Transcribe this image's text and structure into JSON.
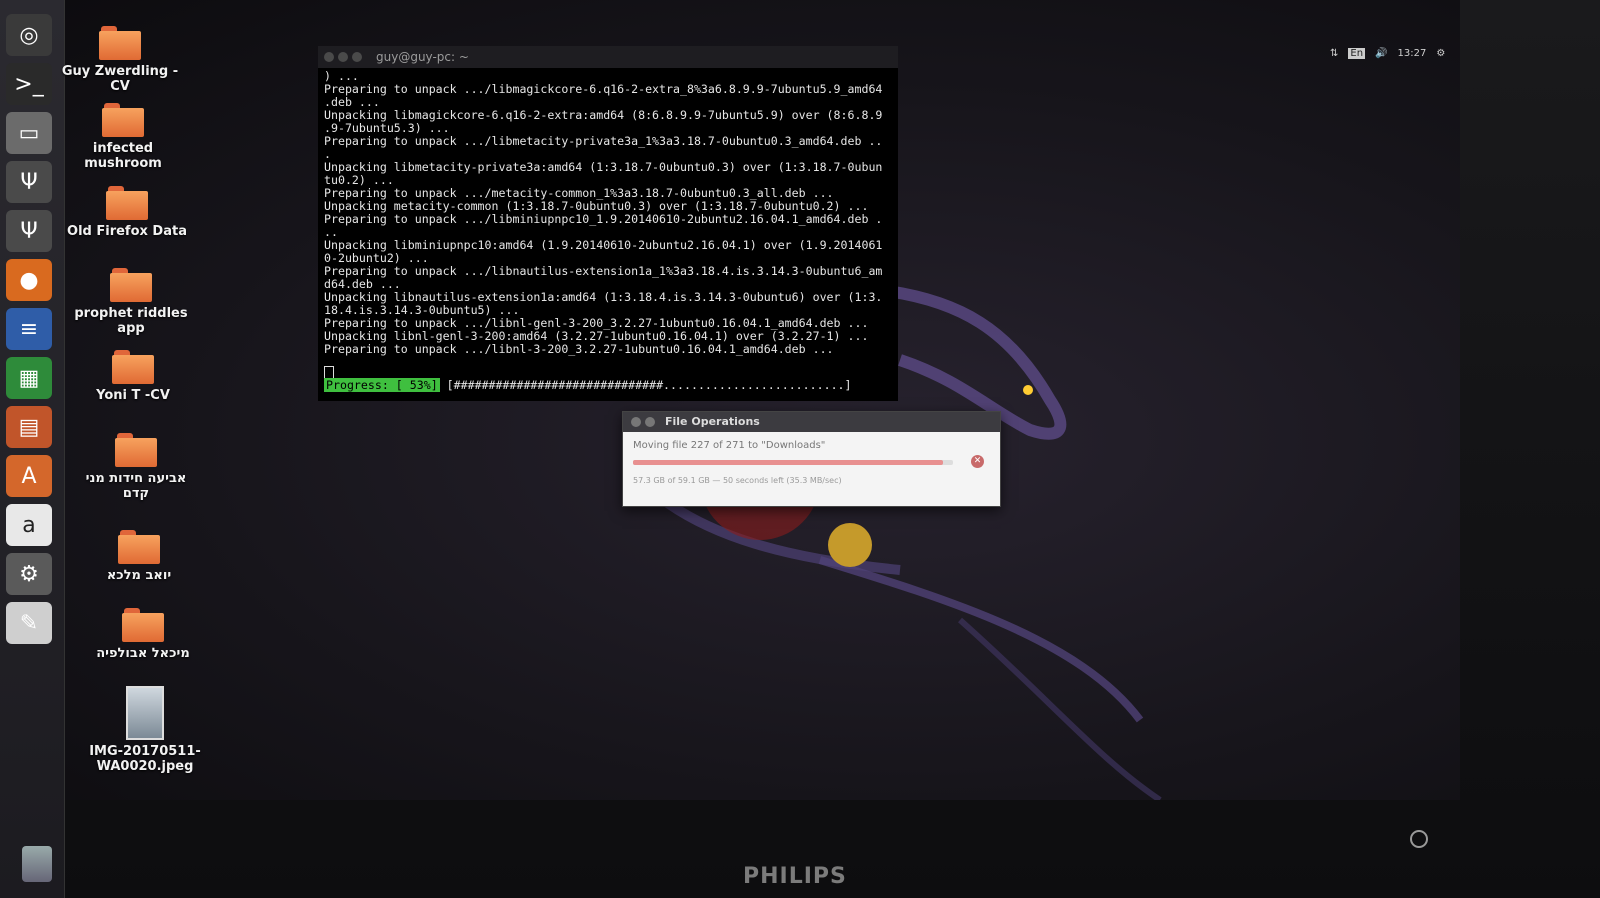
{
  "launcher": {
    "items": [
      {
        "name": "ubuntu-home-icon",
        "glyph": "◎",
        "bg": "#3a3a3a"
      },
      {
        "name": "terminal-icon",
        "glyph": ">_",
        "bg": "#2a2a2a"
      },
      {
        "name": "files-icon",
        "glyph": "▭",
        "bg": "#6b6b6b"
      },
      {
        "name": "usb-drive-icon",
        "glyph": "Ψ",
        "bg": "#4a4a4a"
      },
      {
        "name": "usb-drive-2-icon",
        "glyph": "Ψ",
        "bg": "#4a4a4a"
      },
      {
        "name": "firefox-icon",
        "glyph": "●",
        "bg": "#d96a1f"
      },
      {
        "name": "writer-icon",
        "glyph": "≡",
        "bg": "#2f5da8"
      },
      {
        "name": "calc-icon",
        "glyph": "▦",
        "bg": "#2e8b3a"
      },
      {
        "name": "impress-icon",
        "glyph": "▤",
        "bg": "#c1552a"
      },
      {
        "name": "software-center-icon",
        "glyph": "A",
        "bg": "#d4672b"
      },
      {
        "name": "amazon-icon",
        "glyph": "a",
        "bg": "#e8e8e8"
      },
      {
        "name": "settings-icon",
        "glyph": "⚙",
        "bg": "#5a5a5a"
      },
      {
        "name": "text-editor-icon",
        "glyph": "✎",
        "bg": "#cfcfcf"
      }
    ]
  },
  "desktop": {
    "icons": [
      {
        "label": "Guy Zwerdling - CV",
        "type": "folder"
      },
      {
        "label": "infected mushroom",
        "type": "folder"
      },
      {
        "label": "Old Firefox Data",
        "type": "folder"
      },
      {
        "label": "prophet riddles app",
        "type": "folder"
      },
      {
        "label": "Yoni T -CV",
        "type": "folder"
      },
      {
        "label": "אביעה חידות מני קדם",
        "type": "folder"
      },
      {
        "label": "יואב מלכא",
        "type": "folder"
      },
      {
        "label": "מיכאל אבולפיה",
        "type": "folder"
      },
      {
        "label": "IMG-20170511-WA0020.jpeg",
        "type": "image"
      }
    ]
  },
  "terminal": {
    "title": "guy@guy-pc: ~",
    "lines": [
      ") ...",
      "Preparing to unpack .../libmagickcore-6.q16-2-extra_8%3a6.8.9.9-7ubuntu5.9_amd64",
      ".deb ...",
      "Unpacking libmagickcore-6.q16-2-extra:amd64 (8:6.8.9.9-7ubuntu5.9) over (8:6.8.9",
      ".9-7ubuntu5.3) ...",
      "Preparing to unpack .../libmetacity-private3a_1%3a3.18.7-0ubuntu0.3_amd64.deb ..",
      ".",
      "Unpacking libmetacity-private3a:amd64 (1:3.18.7-0ubuntu0.3) over (1:3.18.7-0ubun",
      "tu0.2) ...",
      "Preparing to unpack .../metacity-common_1%3a3.18.7-0ubuntu0.3_all.deb ...",
      "Unpacking metacity-common (1:3.18.7-0ubuntu0.3) over (1:3.18.7-0ubuntu0.2) ...",
      "Preparing to unpack .../libminiupnpc10_1.9.20140610-2ubuntu2.16.04.1_amd64.deb .",
      "..",
      "Unpacking libminiupnpc10:amd64 (1.9.20140610-2ubuntu2.16.04.1) over (1.9.2014061",
      "0-2ubuntu2) ...",
      "Preparing to unpack .../libnautilus-extension1a_1%3a3.18.4.is.3.14.3-0ubuntu6_am",
      "d64.deb ...",
      "Unpacking libnautilus-extension1a:amd64 (1:3.18.4.is.3.14.3-0ubuntu6) over (1:3.",
      "18.4.is.3.14.3-0ubuntu5) ...",
      "Preparing to unpack .../libnl-genl-3-200_3.2.27-1ubuntu0.16.04.1_amd64.deb ...",
      "Unpacking libnl-genl-3-200:amd64 (3.2.27-1ubuntu0.16.04.1) over (3.2.27-1) ...",
      "Preparing to unpack .../libnl-3-200_3.2.27-1ubuntu0.16.04.1_amd64.deb ..."
    ],
    "progress_label": "Progress: [ 53%]",
    "progress_bar": "[##############################..........................]",
    "progress_fraction": 0.53
  },
  "file_operations": {
    "title": "File Operations",
    "message": "Moving file 227 of 271 to \"Downloads\"",
    "detail": "57.3 GB of 59.1 GB — 50 seconds left (35.3 MB/sec)",
    "progress_fraction": 0.97
  },
  "top_panel": {
    "network": "⇅",
    "keyboard": "En",
    "volume": "🔊",
    "time": "13:27",
    "settings": "⚙"
  },
  "monitor": {
    "brand": "PHILIPS"
  }
}
